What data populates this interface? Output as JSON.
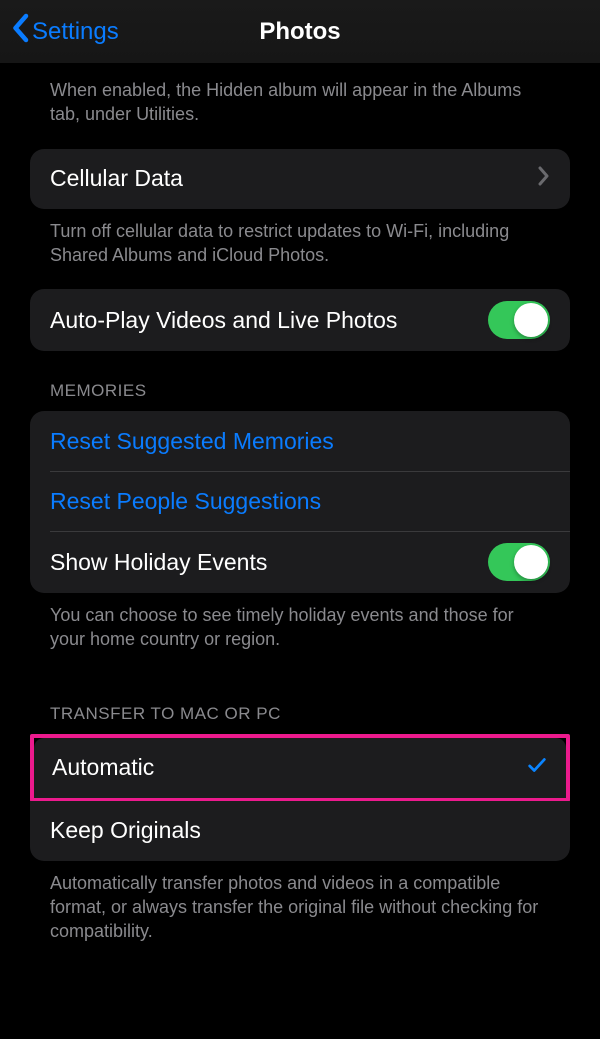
{
  "nav": {
    "back_label": "Settings",
    "title": "Photos"
  },
  "hidden_footer": "When enabled, the Hidden album will appear in the Albums tab, under Utilities.",
  "cellular": {
    "label": "Cellular Data",
    "footer": "Turn off cellular data to restrict updates to Wi-Fi, including Shared Albums and iCloud Photos."
  },
  "autoplay": {
    "label": "Auto-Play Videos and Live Photos",
    "enabled": true
  },
  "memories": {
    "header": "MEMORIES",
    "reset_suggested": "Reset Suggested Memories",
    "reset_people": "Reset People Suggestions",
    "holiday_label": "Show Holiday Events",
    "holiday_enabled": true,
    "footer": "You can choose to see timely holiday events and those for your home country or region."
  },
  "transfer": {
    "header": "TRANSFER TO MAC OR PC",
    "automatic": "Automatic",
    "keep_originals": "Keep Originals",
    "selected": "automatic",
    "footer": "Automatically transfer photos and videos in a compatible format, or always transfer the original file without checking for compatibility."
  }
}
